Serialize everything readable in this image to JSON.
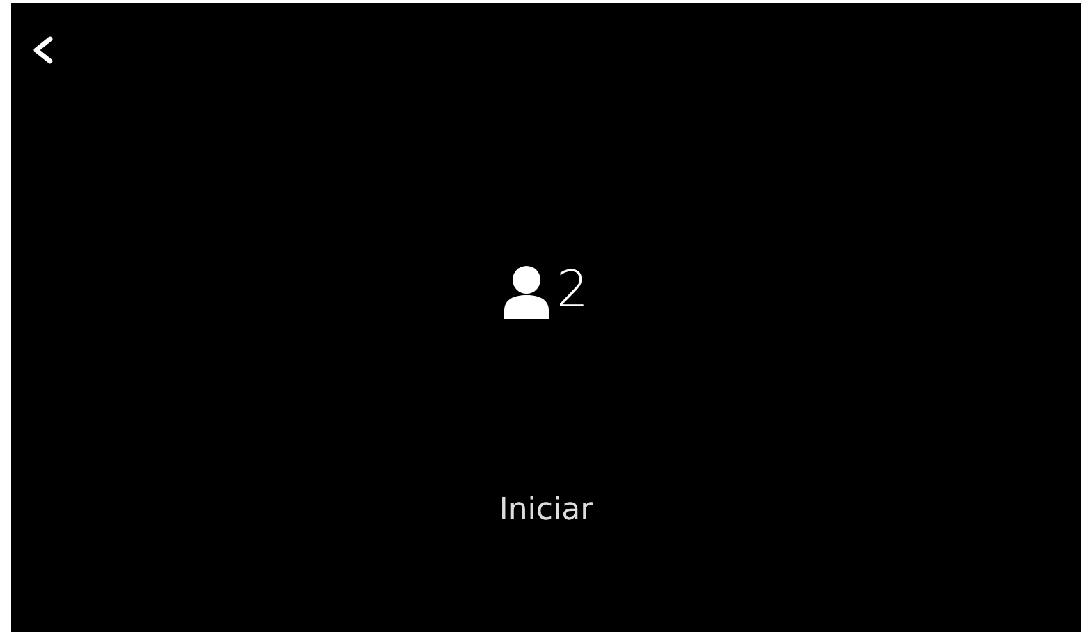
{
  "players": {
    "count": "2"
  },
  "start_button": {
    "label": "Iniciar"
  }
}
